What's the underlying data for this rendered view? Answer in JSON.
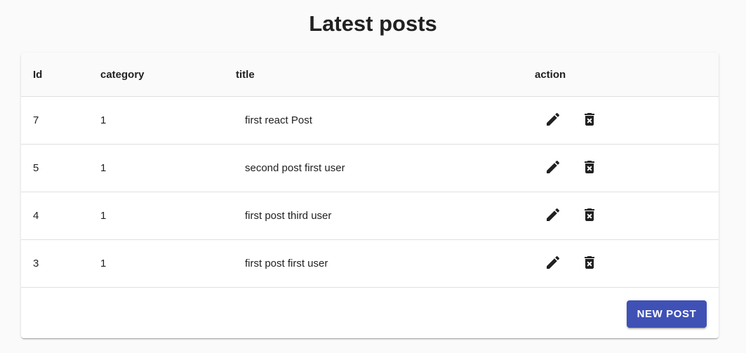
{
  "page": {
    "title": "Latest posts"
  },
  "table": {
    "headers": {
      "id": "Id",
      "category": "category",
      "title": "title",
      "action": "action"
    },
    "rows": [
      {
        "id": "7",
        "category": "1",
        "title": "first react Post"
      },
      {
        "id": "5",
        "category": "1",
        "title": "second post first user"
      },
      {
        "id": "4",
        "category": "1",
        "title": "first post third user"
      },
      {
        "id": "3",
        "category": "1",
        "title": "first post first user"
      }
    ]
  },
  "footer": {
    "new_post_label": "NEW POST"
  },
  "icons": {
    "edit": "edit-icon",
    "delete": "delete-forever-icon"
  },
  "colors": {
    "primary": "#3f51b5",
    "background": "#fafafa",
    "text": "#212121"
  }
}
